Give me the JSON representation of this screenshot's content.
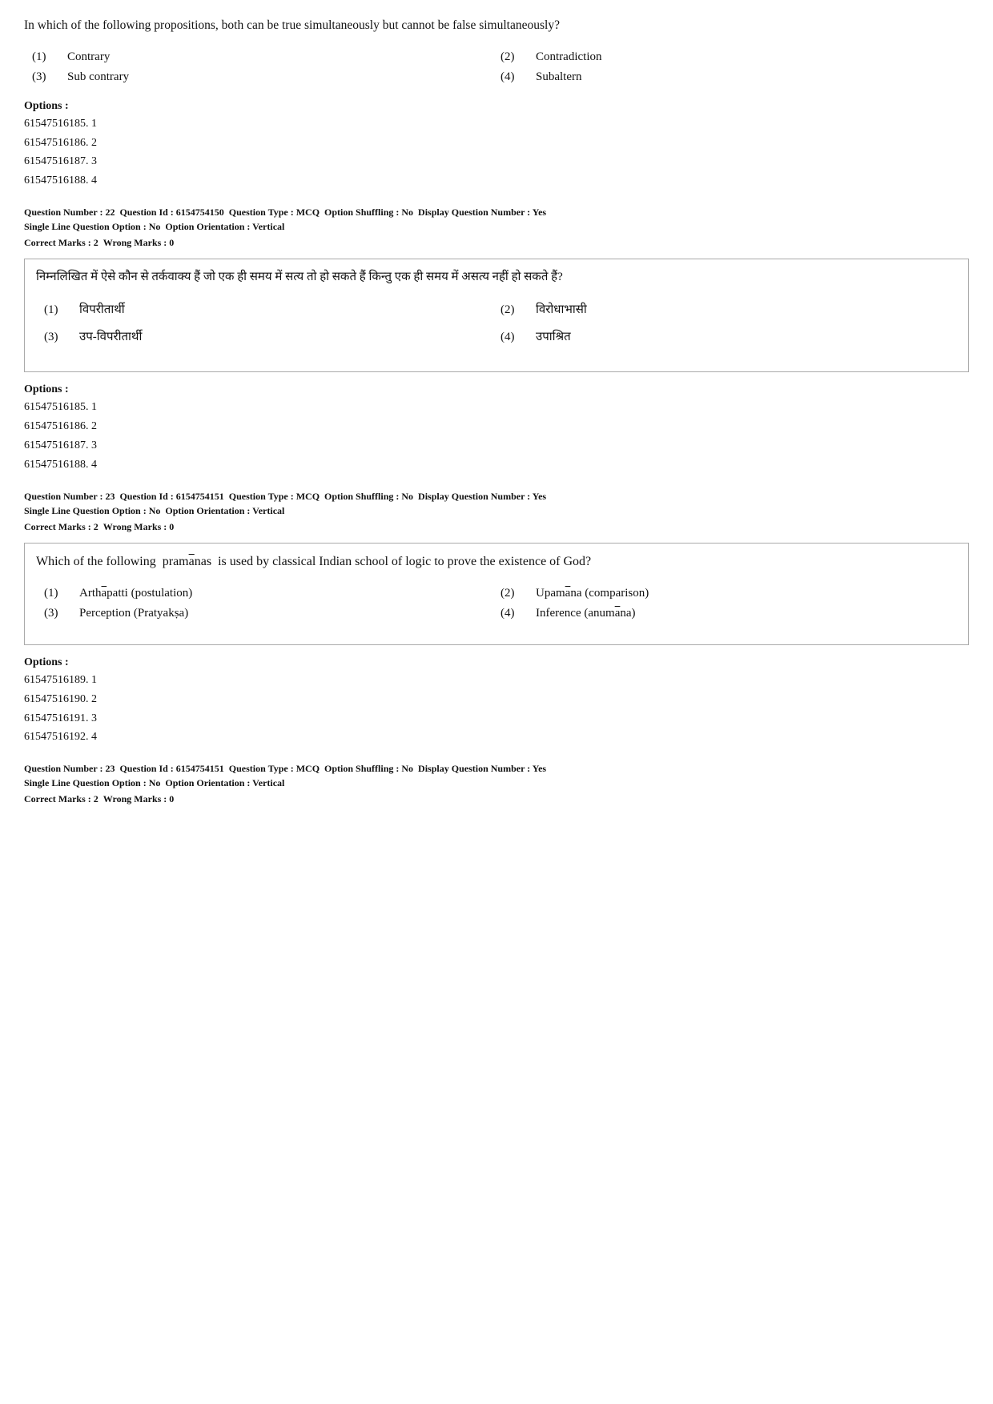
{
  "questions": [
    {
      "id": "q21_english",
      "text": "In which of the following propositions, both can be true simultaneously but cannot be false simultaneously?",
      "options": [
        {
          "num": "(1)",
          "text": "Contrary"
        },
        {
          "num": "(2)",
          "text": "Contradiction"
        },
        {
          "num": "(3)",
          "text": "Sub contrary"
        },
        {
          "num": "(4)",
          "text": "Subaltern"
        }
      ],
      "options_heading": "Options :",
      "options_list": [
        "61547516185. 1",
        "61547516186. 2",
        "61547516187. 3",
        "61547516188. 4"
      ]
    },
    {
      "id": "q22_meta",
      "meta": "Question Number : 22  Question Id : 6154754150  Question Type : MCQ  Option Shuffling : No  Display Question Number : Yes  Single Line Question Option : No  Option Orientation : Vertical",
      "correct_marks": "Correct Marks : 2  Wrong Marks : 0",
      "hindi_question": "निम्नलिखित में ऐसे कौन से तर्कवाक्य हैं जो एक ही समय में सत्य तो हो सकते हैं किन्तु एक ही समय में असत्य नहीं हो सकते हैं?",
      "options": [
        {
          "num": "(1)",
          "text": "विपरीतार्थी"
        },
        {
          "num": "(2)",
          "text": "विरोधाभासी"
        },
        {
          "num": "(3)",
          "text": "उप-विपरीतार्थी"
        },
        {
          "num": "(4)",
          "text": "उपाश्रित"
        }
      ],
      "options_heading": "Options :",
      "options_list": [
        "61547516185. 1",
        "61547516186. 2",
        "61547516187. 3",
        "61547516188. 4"
      ]
    },
    {
      "id": "q23_meta",
      "meta": "Question Number : 23  Question Id : 6154754151  Question Type : MCQ  Option Shuffling : No  Display Question Number : Yes  Single Line Question Option : No  Option Orientation : Vertical",
      "correct_marks": "Correct Marks : 2  Wrong Marks : 0",
      "english_question_line1": "Which of the following  pramānas  is used by classical Indian school of logic to prove the",
      "english_question_line2": "existence of God?",
      "options": [
        {
          "num": "(1)",
          "text": "Arthāpatti (postulation)"
        },
        {
          "num": "(2)",
          "text": "Upamāna (comparison)"
        },
        {
          "num": "(3)",
          "text": "Perception (Pratyakṣa)"
        },
        {
          "num": "(4)",
          "text": "Inference (anumāna)"
        }
      ],
      "options_heading": "Options :",
      "options_list": [
        "61547516189. 1",
        "61547516190. 2",
        "61547516191. 3",
        "61547516192. 4"
      ]
    },
    {
      "id": "q23_meta2",
      "meta": "Question Number : 23  Question Id : 6154754151  Question Type : MCQ  Option Shuffling : No  Display Question Number : Yes  Single Line Question Option : No  Option Orientation : Vertical",
      "correct_marks": "Correct Marks : 2  Wrong Marks : 0"
    }
  ]
}
